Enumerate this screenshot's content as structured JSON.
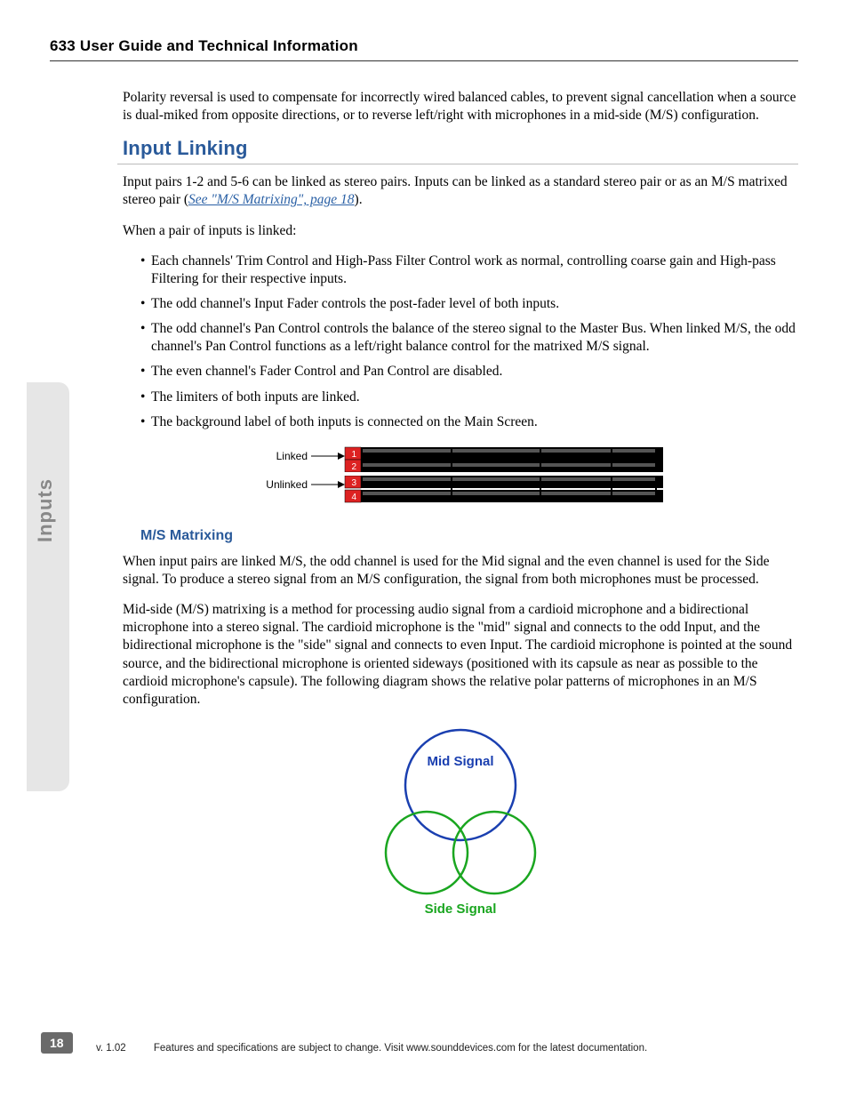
{
  "header": {
    "title": "633 User Guide and Technical Information"
  },
  "sidebar": {
    "label": "Inputs"
  },
  "page_number": "18",
  "footer": {
    "version": "v. 1.02",
    "note": "Features and specifications are subject to change. Visit www.sounddevices.com for the latest documentation."
  },
  "intro": {
    "polarity": "Polarity reversal is used to compensate for incorrectly wired balanced cables, to prevent signal cancellation when a source is dual-miked from opposite directions, or to reverse left/right with microphones in a mid-side (M/S) configuration."
  },
  "input_linking": {
    "title": "Input Linking",
    "para1a": "Input pairs 1-2 and 5-6 can be linked as stereo pairs. Inputs can be linked as a standard stereo pair or as an M/S matrixed stereo pair (",
    "link": "See \"M/S Matrixing\", page 18",
    "para1b": ").",
    "para2": "When a pair of inputs is linked:",
    "bullets": [
      "Each channels' Trim Control and High-Pass Filter Control work as normal, controlling coarse gain and High-pass Filtering for their respective inputs.",
      "The odd channel's Input Fader controls the post-fader level of both inputs.",
      "The odd channel's Pan Control controls the balance of the stereo signal to the Master Bus. When linked M/S, the odd channel's Pan Control functions as a left/right balance control for the matrixed M/S signal.",
      "The even channel's Fader Control and Pan Control are disabled.",
      "The limiters of both inputs are linked.",
      "The background label of both inputs is connected on the Main Screen."
    ]
  },
  "meter": {
    "linked_label": "Linked",
    "unlinked_label": "Unlinked",
    "rows": [
      "1",
      "2",
      "3",
      "4"
    ]
  },
  "ms": {
    "title": "M/S Matrixing",
    "para1": "When input pairs are linked M/S, the odd channel is used for the Mid signal and the even channel is used for the Side signal. To produce a stereo signal from an M/S configuration, the signal from both microphones must be processed.",
    "para2": "Mid-side (M/S) matrixing is a method for processing audio signal from a cardioid microphone and a bidirectional microphone into a stereo signal. The cardioid microphone is the \"mid\" signal and connects to the odd Input, and the bidirectional microphone is the \"side\" signal and connects to even Input. The cardioid microphone is pointed at the sound source, and the bidirectional microphone is oriented sideways (positioned with its capsule as near as possible to the cardioid microphone's capsule). The following diagram shows the relative polar patterns of microphones in an M/S configuration.",
    "mid_label": "Mid Signal",
    "side_label": "Side Signal"
  }
}
